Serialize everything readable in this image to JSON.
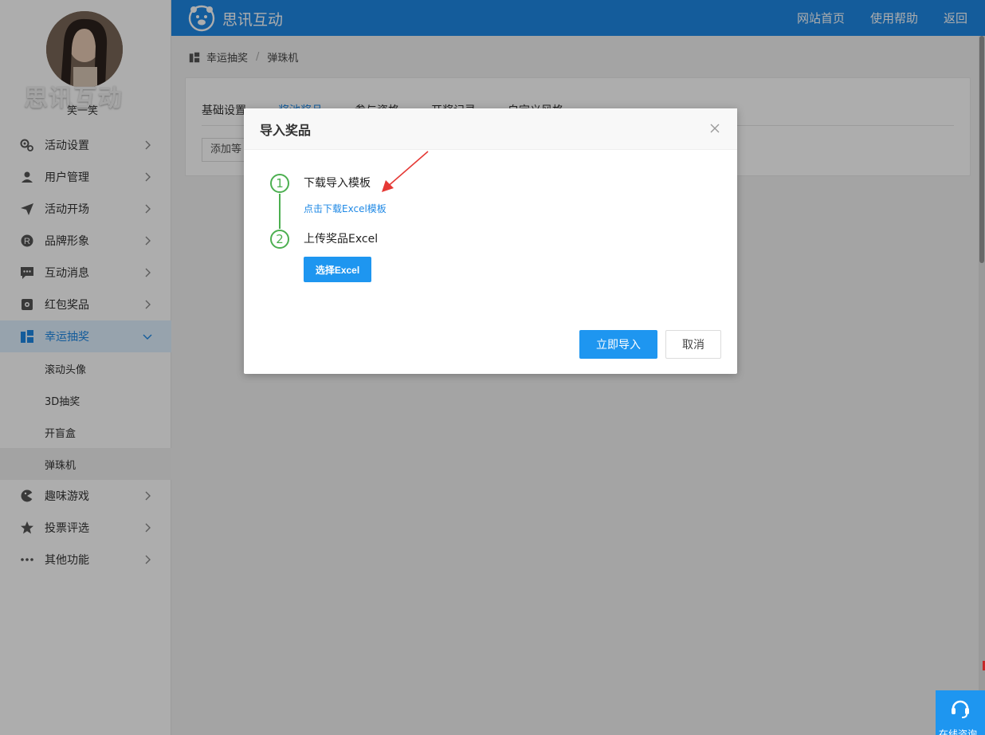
{
  "app": {
    "brand_name": "思讯互动",
    "username": "笑一笑",
    "accent_color": "#1e88e5"
  },
  "topbar": {
    "logo_text": "思讯互动",
    "nav": [
      "网站首页",
      "使用帮助",
      "返回"
    ]
  },
  "sidebar": {
    "items": [
      {
        "label": "活动设置",
        "icon": "gears-icon"
      },
      {
        "label": "用户管理",
        "icon": "user-card-icon"
      },
      {
        "label": "活动开场",
        "icon": "paper-plane-icon"
      },
      {
        "label": "品牌形象",
        "icon": "registered-icon"
      },
      {
        "label": "互动消息",
        "icon": "chat-bubble-icon"
      },
      {
        "label": "红包奖品",
        "icon": "red-packet-icon"
      },
      {
        "label": "幸运抽奖",
        "icon": "lucky-draw-icon",
        "expanded": true
      },
      {
        "label": "趣味游戏",
        "icon": "game-icon"
      },
      {
        "label": "投票评选",
        "icon": "star-icon"
      },
      {
        "label": "其他功能",
        "icon": "more-dots-icon"
      }
    ],
    "lucky_draw_sub": [
      "滚动头像",
      "3D抽奖",
      "开盲盒",
      "弹珠机"
    ],
    "selected_sub": "弹珠机"
  },
  "breadcrumb": [
    "幸运抽奖",
    "弹珠机"
  ],
  "tabs": [
    "基础设置",
    "奖池奖品",
    "参与资格",
    "开奖记录",
    "自定义风格"
  ],
  "active_tab": "奖池奖品",
  "add_button": "添加等",
  "modal": {
    "title": "导入奖品",
    "step1": {
      "num": "1",
      "title": "下载导入模板",
      "link": "点击下载Excel模板"
    },
    "step2": {
      "num": "2",
      "title": "上传奖品Excel",
      "button": "选择Excel"
    },
    "confirm": "立即导入",
    "cancel": "取消"
  },
  "help_widget": {
    "label": "在线咨询"
  }
}
